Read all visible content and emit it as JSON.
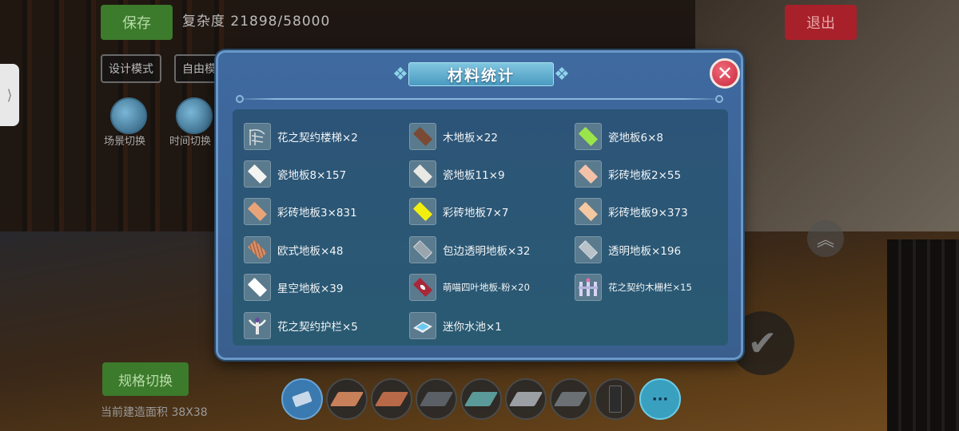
{
  "hud": {
    "save_label": "保存",
    "complexity_label": "复杂度 21898/58000",
    "exit_label": "退出",
    "mode_design": "设计模式",
    "mode_free": "自由模",
    "scene_switch": "场景切换",
    "time_switch": "时间切换",
    "spec_switch": "规格切换",
    "build_area": "当前建造面积 38X38",
    "side_handle": "⟩"
  },
  "modal": {
    "title": "材料统计",
    "close_symbol": "✕",
    "items": [
      {
        "label": "花之契约楼梯×2",
        "icon": "stairs-icon",
        "color": "#cfd8dc"
      },
      {
        "label": "木地板×22",
        "icon": "wood-floor-icon",
        "color": "#7a4a34"
      },
      {
        "label": "瓷地板6×8",
        "icon": "tile-floor-icon",
        "color": "#9ae64a"
      },
      {
        "label": "瓷地板8×157",
        "icon": "tile-floor-icon",
        "color": "#f4f4f0"
      },
      {
        "label": "瓷地板11×9",
        "icon": "tile-floor-icon",
        "color": "#e8e8e4"
      },
      {
        "label": "彩砖地板2×55",
        "icon": "colored-tile-icon",
        "color": "#f2c2a8"
      },
      {
        "label": "彩砖地板3×831",
        "icon": "colored-tile-icon",
        "color": "#e8a478"
      },
      {
        "label": "彩砖地板7×7",
        "icon": "colored-tile-icon",
        "color": "#f2ee10"
      },
      {
        "label": "彩砖地板9×373",
        "icon": "colored-tile-icon",
        "color": "#f4c8a0"
      },
      {
        "label": "欧式地板×48",
        "icon": "european-floor-icon",
        "color": "#d4906a"
      },
      {
        "label": "包边透明地板×32",
        "icon": "glass-floor-icon",
        "color": "#9aa6ae"
      },
      {
        "label": "透明地板×196",
        "icon": "glass-floor-icon",
        "color": "#b8c2c8"
      },
      {
        "label": "星空地板×39",
        "icon": "starry-floor-icon",
        "color": "#ffffff"
      },
      {
        "label": "萌喵四叶地板-粉×20",
        "icon": "clover-floor-icon",
        "color": "#a8283a"
      },
      {
        "label": "花之契约木栅栏×15",
        "icon": "fence-icon",
        "color": "#d8d4f4"
      },
      {
        "label": "花之契约护栏×5",
        "icon": "railing-icon",
        "color": "#f4f4f4"
      },
      {
        "label": "迷你水池×1",
        "icon": "pool-icon",
        "color": "#6ac8f0"
      }
    ]
  },
  "tray": {
    "more_label": "···",
    "slots": [
      {
        "icon": "eraser-icon",
        "color": "#c8d8e8"
      },
      {
        "icon": "brick-tile-icon",
        "color": "#c8805a"
      },
      {
        "icon": "brick-tile-icon",
        "color": "#b86a48"
      },
      {
        "icon": "gray-tile-icon",
        "color": "#5a6066"
      },
      {
        "icon": "teal-tile-icon",
        "color": "#5a9a98"
      },
      {
        "icon": "light-tile-icon",
        "color": "#9aa0a4"
      },
      {
        "icon": "gray-tile-icon",
        "color": "#6a7074"
      },
      {
        "icon": "door-icon",
        "color": "#2c2c2c"
      }
    ]
  },
  "colors": {
    "accent": "#3f6aa0",
    "close": "#c8283c",
    "save": "#3c7a2c",
    "exit": "#a8202a"
  }
}
